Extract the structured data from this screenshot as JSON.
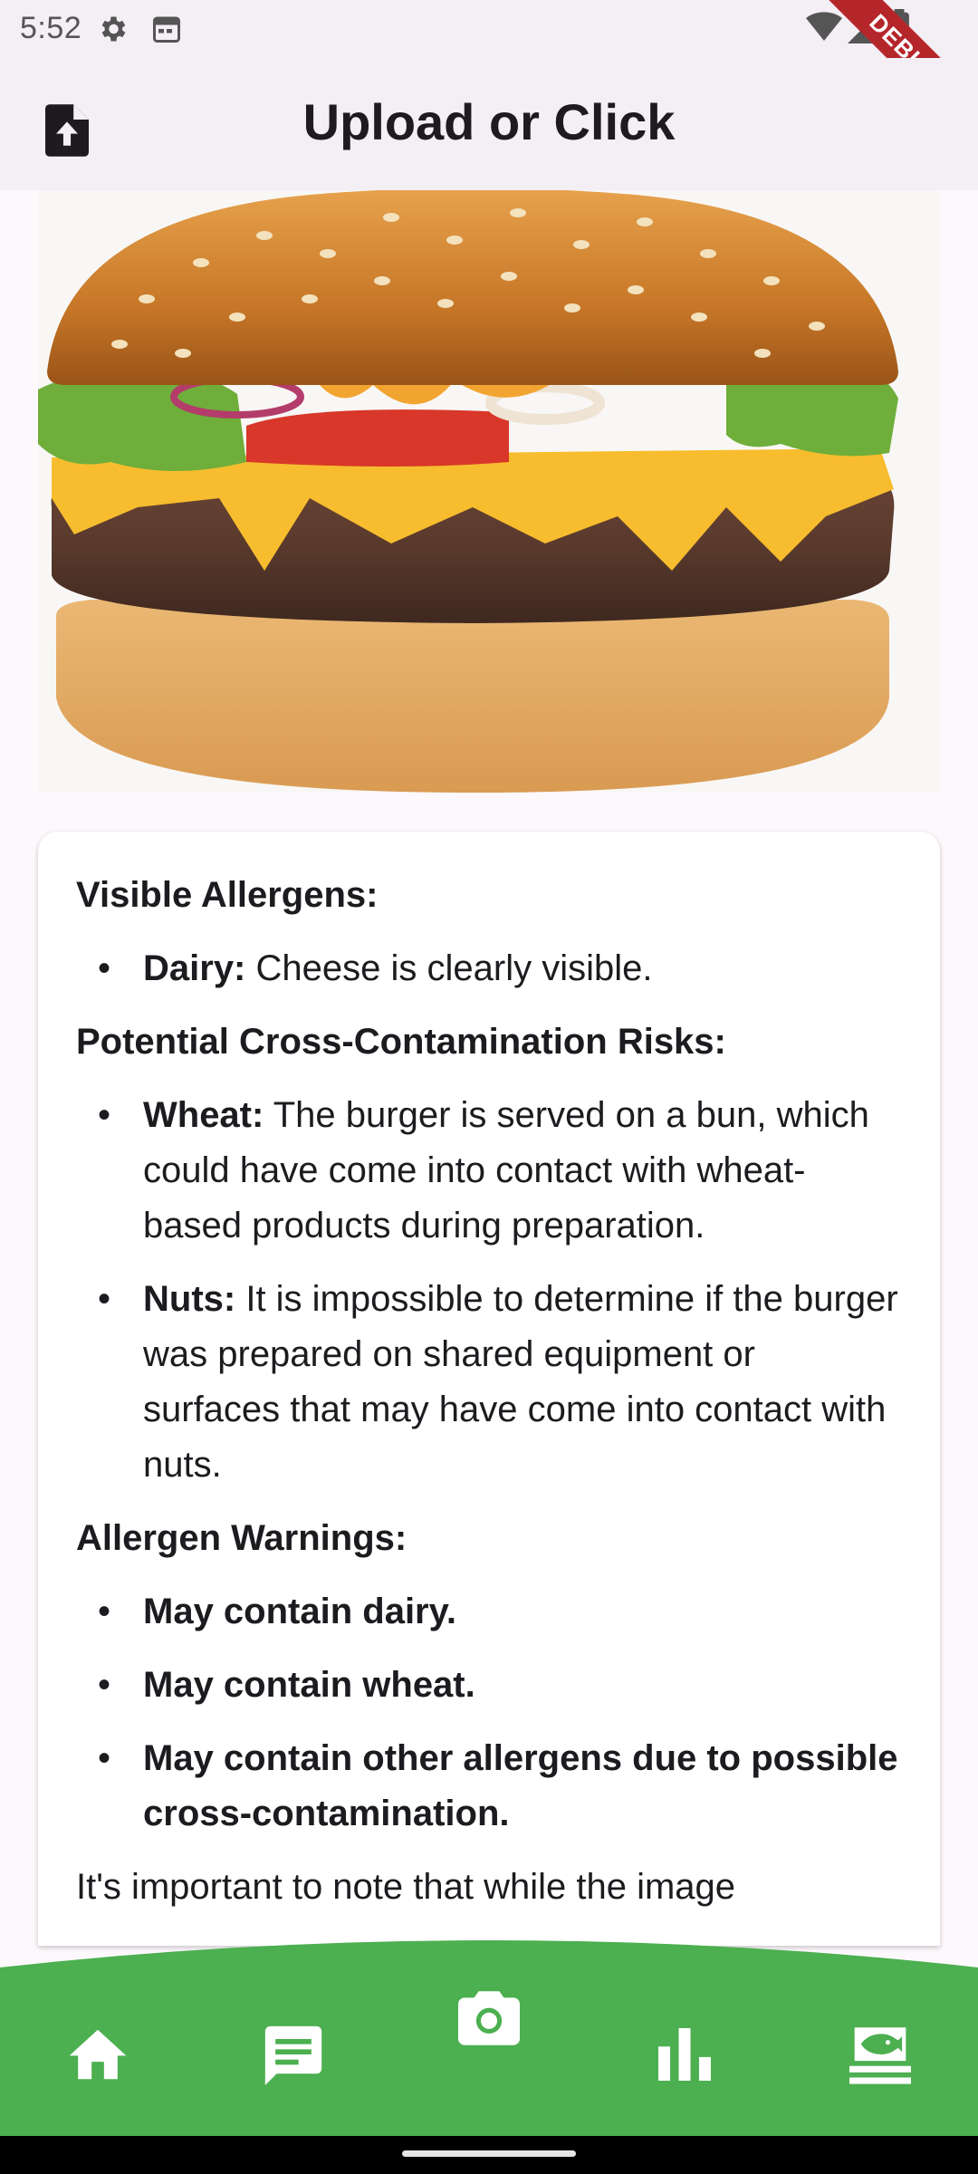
{
  "status_bar": {
    "time": "5:52",
    "icons": [
      "settings-icon",
      "calendar-icon",
      "wifi-icon",
      "signal-icon",
      "battery-icon"
    ],
    "debug_label": "DEBUG"
  },
  "app_bar": {
    "title": "Upload or Click",
    "upload_icon": "upload-file-icon"
  },
  "image": {
    "subject": "cheeseburger photo"
  },
  "analysis": {
    "visible_allergens": {
      "heading": "Visible Allergens:",
      "items": [
        {
          "label": "Dairy:",
          "text": " Cheese is clearly visible."
        }
      ]
    },
    "cross_contamination": {
      "heading": "Potential Cross-Contamination Risks:",
      "items": [
        {
          "label": "Wheat:",
          "text": " The burger is served on a bun, which could have come into contact with wheat-based products during preparation."
        },
        {
          "label": "Nuts:",
          "text": " It is impossible to determine if the burger was prepared on shared equipment or surfaces that may have come into contact with nuts."
        }
      ]
    },
    "warnings": {
      "heading": "Allergen Warnings:",
      "items": [
        "May contain dairy.",
        "May contain wheat.",
        "May contain other allergens due to possible cross-contamination."
      ]
    },
    "note": "It's important to note that while the image"
  },
  "bottom_nav": {
    "color": "#4caf50",
    "items": [
      {
        "name": "home",
        "icon": "home-icon"
      },
      {
        "name": "chat",
        "icon": "chat-icon"
      },
      {
        "name": "camera",
        "icon": "camera-icon"
      },
      {
        "name": "stats",
        "icon": "bar-chart-icon"
      },
      {
        "name": "food",
        "icon": "set-meal-icon"
      }
    ]
  },
  "bullet": "•"
}
